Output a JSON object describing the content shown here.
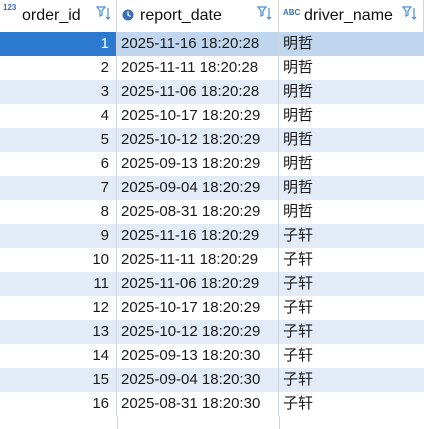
{
  "columns": [
    {
      "name": "order_id",
      "type_icon": "123"
    },
    {
      "name": "report_date",
      "type_icon": "clock"
    },
    {
      "name": "driver_name",
      "type_icon": "ABC"
    }
  ],
  "rows": [
    {
      "order_id": "1",
      "report_date": "2025-11-16 18:20:28",
      "driver_name": "明哲"
    },
    {
      "order_id": "2",
      "report_date": "2025-11-11 18:20:28",
      "driver_name": "明哲"
    },
    {
      "order_id": "3",
      "report_date": "2025-11-06 18:20:28",
      "driver_name": "明哲"
    },
    {
      "order_id": "4",
      "report_date": "2025-10-17 18:20:29",
      "driver_name": "明哲"
    },
    {
      "order_id": "5",
      "report_date": "2025-10-12 18:20:29",
      "driver_name": "明哲"
    },
    {
      "order_id": "6",
      "report_date": "2025-09-13 18:20:29",
      "driver_name": "明哲"
    },
    {
      "order_id": "7",
      "report_date": "2025-09-04 18:20:29",
      "driver_name": "明哲"
    },
    {
      "order_id": "8",
      "report_date": "2025-08-31 18:20:29",
      "driver_name": "明哲"
    },
    {
      "order_id": "9",
      "report_date": "2025-11-16 18:20:29",
      "driver_name": "子轩"
    },
    {
      "order_id": "10",
      "report_date": "2025-11-11 18:20:29",
      "driver_name": "子轩"
    },
    {
      "order_id": "11",
      "report_date": "2025-11-06 18:20:29",
      "driver_name": "子轩"
    },
    {
      "order_id": "12",
      "report_date": "2025-10-17 18:20:29",
      "driver_name": "子轩"
    },
    {
      "order_id": "13",
      "report_date": "2025-10-12 18:20:29",
      "driver_name": "子轩"
    },
    {
      "order_id": "14",
      "report_date": "2025-09-13 18:20:30",
      "driver_name": "子轩"
    },
    {
      "order_id": "15",
      "report_date": "2025-09-04 18:20:30",
      "driver_name": "子轩"
    },
    {
      "order_id": "16",
      "report_date": "2025-08-31 18:20:30",
      "driver_name": "子轩"
    }
  ],
  "selected_row": 0,
  "colors": {
    "selected": "#2b7ad0",
    "alt_row": "#e3ebf6",
    "type_icon": "#3c6fb4"
  }
}
